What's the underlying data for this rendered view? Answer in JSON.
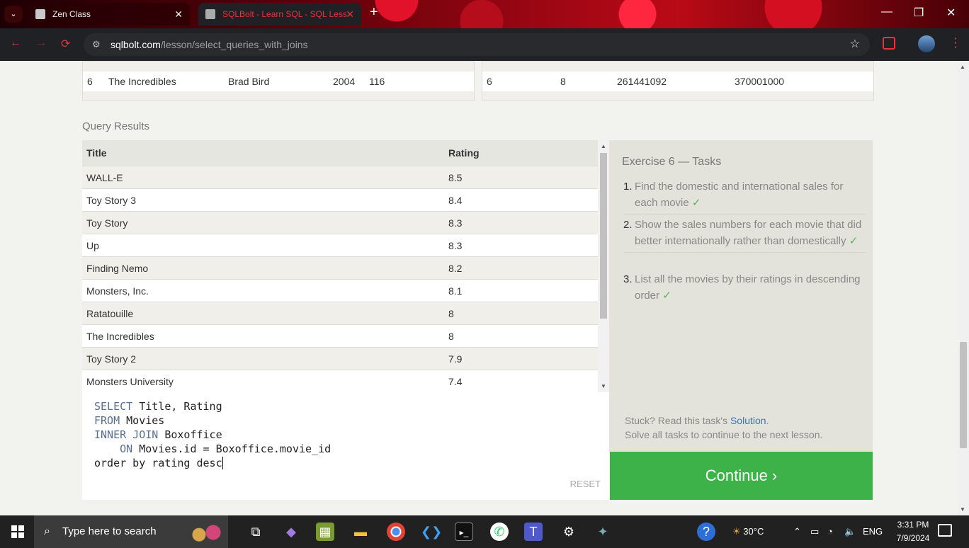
{
  "browser": {
    "tabs": [
      {
        "label": "Zen Class"
      },
      {
        "label": "SQLBolt - Learn SQL - SQL Less"
      }
    ],
    "url_domain": "sqlbolt.com",
    "url_path": "/lesson/select_queries_with_joins"
  },
  "top_tables": {
    "movies_row": {
      "id": "6",
      "title": "The Incredibles",
      "director": "Brad Bird",
      "year": "2004",
      "length": "116"
    },
    "boxoffice_row": {
      "movie_id": "6",
      "rating": "8",
      "domestic": "261441092",
      "international": "370001000"
    }
  },
  "query_results": {
    "label": "Query Results",
    "columns": [
      "Title",
      "Rating"
    ],
    "rows": [
      {
        "title": "WALL-E",
        "rating": "8.5"
      },
      {
        "title": "Toy Story 3",
        "rating": "8.4"
      },
      {
        "title": "Toy Story",
        "rating": "8.3"
      },
      {
        "title": "Up",
        "rating": "8.3"
      },
      {
        "title": "Finding Nemo",
        "rating": "8.2"
      },
      {
        "title": "Monsters, Inc.",
        "rating": "8.1"
      },
      {
        "title": "Ratatouille",
        "rating": "8"
      },
      {
        "title": "The Incredibles",
        "rating": "8"
      },
      {
        "title": "Toy Story 2",
        "rating": "7.9"
      },
      {
        "title": "Monsters University",
        "rating": "7.4"
      }
    ]
  },
  "editor": {
    "lines": [
      {
        "kw": "SELECT",
        "rest": " Title, Rating"
      },
      {
        "kw": "FROM",
        "rest": " Movies"
      },
      {
        "kw": "INNER JOIN",
        "rest": " Boxoffice"
      },
      {
        "kw": "    ON",
        "rest": " Movies.id = Boxoffice.movie_id"
      },
      {
        "kw": "",
        "rest": "order by rating desc"
      }
    ],
    "reset_label": "RESET"
  },
  "exercise": {
    "title": "Exercise 6 — Tasks",
    "tasks": [
      {
        "n": "1.",
        "text": "Find the domestic and international sales for each movie",
        "check": "✓"
      },
      {
        "n": "2.",
        "text": "Show the sales numbers for each movie that did better internationally rather than domestically",
        "check": "✓"
      },
      {
        "n": "3.",
        "text": "List all the movies by their ratings in descending order",
        "check": "✓"
      }
    ],
    "stuck_text": "Stuck? Read this task's",
    "solution_link": "Solution",
    "stuck_suffix": ".",
    "continue_hint": "Solve all tasks to continue to the next lesson.",
    "continue_label": "Continue ›"
  },
  "taskbar": {
    "search_placeholder": "Type here to search",
    "weather": "30°C",
    "language": "ENG",
    "time": "3:31 PM",
    "date": "7/9/2024"
  }
}
